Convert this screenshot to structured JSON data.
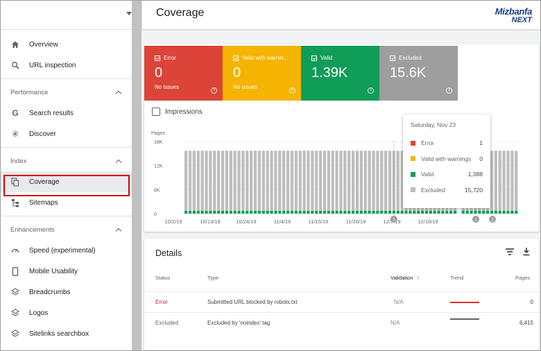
{
  "header": {
    "title": "Coverage"
  },
  "logo": {
    "line1": "Mizbanfa",
    "line2": "NEXT"
  },
  "sidebar": {
    "top_items": [
      {
        "label": "Overview",
        "icon": "home-icon"
      },
      {
        "label": "URL inspection",
        "icon": "search-icon"
      }
    ],
    "sections": [
      {
        "title": "Performance",
        "items": [
          {
            "label": "Search results",
            "icon": "google-g-icon"
          },
          {
            "label": "Discover",
            "icon": "asterisk-icon"
          }
        ]
      },
      {
        "title": "Index",
        "items": [
          {
            "label": "Coverage",
            "icon": "copy-icon",
            "active": true
          },
          {
            "label": "Sitemaps",
            "icon": "sitemap-icon"
          }
        ]
      },
      {
        "title": "Enhancements",
        "items": [
          {
            "label": "Speed (experimental)",
            "icon": "gauge-icon"
          },
          {
            "label": "Mobile Usability",
            "icon": "phone-icon"
          },
          {
            "label": "Breadcrumbs",
            "icon": "layers-icon"
          },
          {
            "label": "Logos",
            "icon": "layers-icon"
          },
          {
            "label": "Sitelinks searchbox",
            "icon": "layers-icon"
          }
        ]
      }
    ]
  },
  "tiles": [
    {
      "name": "error",
      "label": "Error",
      "value": "0",
      "sub": "No issues",
      "color": "#db4437"
    },
    {
      "name": "warning",
      "label": "Valid with warnin...",
      "value": "0",
      "sub": "No issues",
      "color": "#f4b400"
    },
    {
      "name": "valid",
      "label": "Valid",
      "value": "1.39K",
      "sub": "",
      "color": "#0f9d58"
    },
    {
      "name": "excluded",
      "label": "Excluded",
      "value": "15.6K",
      "sub": "",
      "color": "#9e9e9e"
    }
  ],
  "impressions_label": "Impressions",
  "chart_data": {
    "type": "bar",
    "ylabel": "Pages",
    "yticks": [
      "18K",
      "12K",
      "6K",
      "0"
    ],
    "ylim": [
      0,
      18000
    ],
    "x_tick_labels": [
      "10/2/19",
      "10/13/19",
      "10/24/19",
      "11/4/19",
      "11/15/19",
      "11/26/19",
      "12/7/19",
      "12/18/19"
    ],
    "series": [
      {
        "name": "Excluded",
        "color": "#bdbdbd"
      },
      {
        "name": "Valid",
        "color": "#0f9d58"
      }
    ],
    "excluded_value_approx": 15700,
    "valid_value_approx": 1390,
    "bar_count": 82,
    "gap_index": 67,
    "annotations": [
      "1",
      "1",
      "1"
    ]
  },
  "tooltip": {
    "date": "Saturday, Nov 23",
    "rows": [
      {
        "name": "Error",
        "value": "1",
        "color": "#db4437"
      },
      {
        "name": "Valid with warnings",
        "value": "0",
        "color": "#f4b400"
      },
      {
        "name": "Valid",
        "value": "1,388",
        "color": "#0f9d58"
      },
      {
        "name": "Excluded",
        "value": "15,720",
        "color": "#bdbdbd"
      }
    ]
  },
  "details": {
    "title": "Details",
    "columns": {
      "status": "Status",
      "type": "Type",
      "validation": "Validation",
      "trend": "Trend",
      "pages": "Pages"
    },
    "rows": [
      {
        "status": "Error",
        "type": "Submitted URL blocked by robots.txt",
        "validation": "N/A",
        "pages": "0",
        "status_color": "#c5221f",
        "trend_color": "#d93025"
      },
      {
        "status": "Excluded",
        "type": "Excluded by 'noindex' tag",
        "validation": "N/A",
        "pages": "6,415",
        "status_color": "#5f6368",
        "trend_color": "#5f6368"
      }
    ]
  }
}
